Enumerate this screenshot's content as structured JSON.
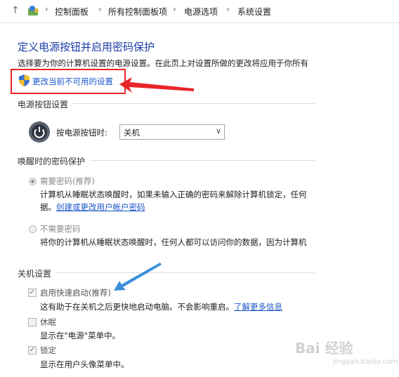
{
  "address_bar": {
    "crumbs": [
      "控制面板",
      "所有控制面板项",
      "电源选项",
      "系统设置"
    ]
  },
  "page": {
    "title": "定义电源按钮并启用密码保护",
    "intro": "选择要为你的计算机设置的电源设置。在此页上对设置所做的更改将应用于你所有",
    "change_link": "更改当前不可用的设置"
  },
  "power_button": {
    "section_title": "电源按钮设置",
    "label": "按电源按钮时:",
    "selected": "关机"
  },
  "wake_password": {
    "section_title": "唤醒时的密码保护",
    "require_label": "需要密码(推荐)",
    "require_desc_1": "计算机从睡眠状态唤醒时，如果未输入正确的密码来解除计算机锁定，任何",
    "require_desc_2_prefix": "据。",
    "require_desc_2_link": "创建或更改用户帐户密码",
    "no_require_label": "不需要密码",
    "no_require_desc": "将你的计算机从睡眠状态唤醒时，任何人都可以访问你的数据，因为计算机"
  },
  "shutdown": {
    "section_title": "关机设置",
    "fast_startup_label": "启用快速启动(推荐)",
    "fast_startup_desc": "这有助于在关机之后更快地启动电脑。不会影响重启。",
    "learn_more": "了解更多信息",
    "sleep_label": "休眠",
    "sleep_desc": "显示在\"电源\"菜单中。",
    "lock_label": "锁定",
    "lock_desc": "显示在用户头像菜单中。"
  },
  "watermark": {
    "text": "Bai 经验",
    "sub": "jingyan.baidu.com"
  },
  "colors": {
    "title_blue": "#1a3ea8",
    "link_blue": "#1a56c9",
    "annotation_red": "#e8262a",
    "annotation_blue": "#3a8fd9"
  }
}
